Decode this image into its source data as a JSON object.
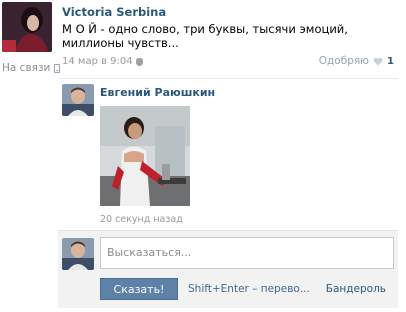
{
  "post": {
    "author": "Victoria Serbina",
    "text": "М О Й - одно слово, три буквы, тысячи эмоций, миллионы чувств...",
    "date": "14 мар в 9:04",
    "like_label": "Одобряю",
    "like_count": "1"
  },
  "status": {
    "text": "На связи"
  },
  "reply": {
    "author": "Евгений Раюшкин",
    "time": "20 секунд назад"
  },
  "comment_box": {
    "placeholder": "Высказаться...",
    "send_label": "Сказать!",
    "hint": "Shift+Enter – перево...",
    "extra_link": "Бандероль"
  },
  "colors": {
    "link": "#2b587a",
    "button": "#5e81a8",
    "muted": "#999999"
  }
}
